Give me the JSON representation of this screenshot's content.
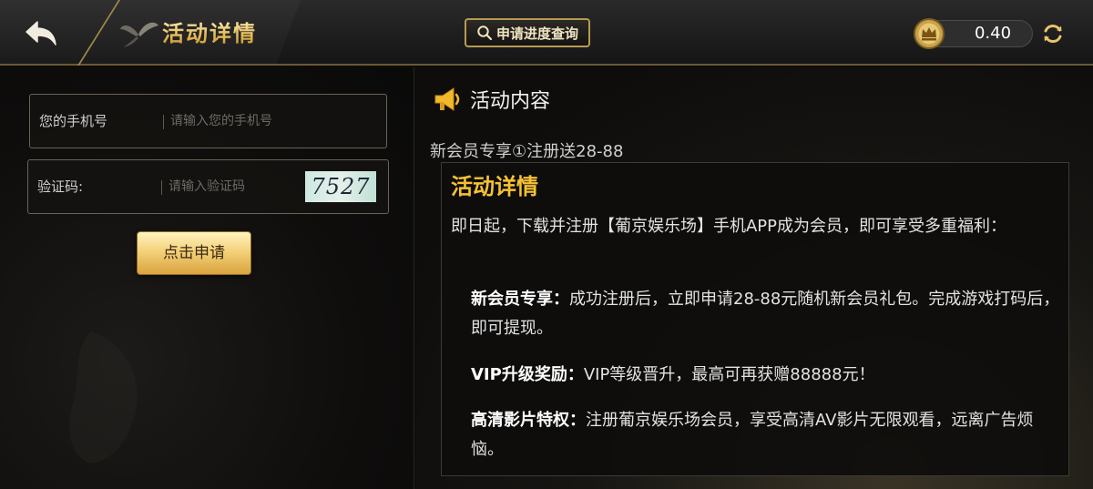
{
  "header": {
    "back_icon": "back-arrow-icon",
    "title": "活动详情",
    "progress_button_label": "申请进度查询",
    "search_icon": "search-icon",
    "balance": "0.40",
    "coin_icon": "crown-coin-icon",
    "refresh_icon": "refresh-icon"
  },
  "form": {
    "phone_label": "您的手机号",
    "phone_placeholder": "请输入您的手机号",
    "phone_value": "",
    "code_label": "验证码:",
    "code_placeholder": "请输入验证码",
    "code_value": "",
    "captcha_text": "7527",
    "submit_label": "点击申请"
  },
  "content": {
    "section_icon": "megaphone-icon",
    "section_title": "活动内容",
    "promo_title": "新会员专享①注册送28-88",
    "detail_title": "活动详情",
    "intro": "即日起，下载并注册【葡京娱乐场】手机APP成为会员，即可享受多重福利：",
    "items": [
      {
        "label": "新会员专享：",
        "text": "成功注册后，立即申请28-88元随机新会员礼包。完成游戏打码后，即可提现。"
      },
      {
        "label": "VIP升级奖励：",
        "text": "VIP等级晋升，最高可再获赠88888元！"
      },
      {
        "label": "高清影片特权：",
        "text": "注册葡京娱乐场会员，享受高清AV影片无限观看，远离广告烦恼。"
      }
    ]
  },
  "colors": {
    "gold_accent": "#f6c233",
    "gold_border": "#b89a52",
    "background": "#0d0c0b"
  }
}
